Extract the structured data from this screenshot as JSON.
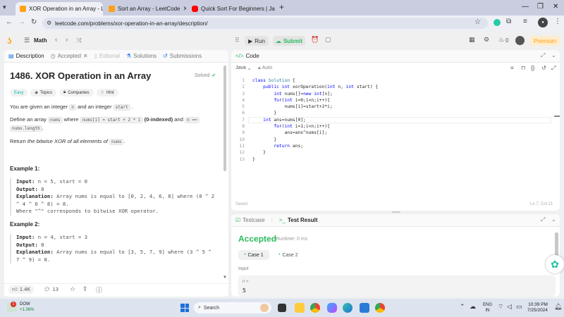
{
  "browser": {
    "tabs": [
      {
        "title": "XOR Operation in an Array - Le",
        "fav_color": "#ffa116"
      },
      {
        "title": "Sort an Array - LeetCode",
        "fav_color": "#ffa116"
      },
      {
        "title": "Quick Sort For Beginners | Java",
        "fav_color": "#ff0000"
      }
    ],
    "new_tab": "+",
    "url": "leetcode.com/problems/xor-operation-in-an-array/description/"
  },
  "header": {
    "problem_list": "Math",
    "run_label": "Run",
    "submit_label": "Submit",
    "streak": "0",
    "premium_label": "Premium"
  },
  "left": {
    "tabs": [
      "Description",
      "Accepted",
      "Editorial",
      "Solutions",
      "Submissions"
    ],
    "title": "1486. XOR Operation in an Array",
    "solved": "Solved",
    "tags": [
      "Easy",
      "Topics",
      "Companies",
      "Hint"
    ],
    "p1_a": "You are given an integer",
    "p1_n": "n",
    "p1_b": "and an integer",
    "p1_start": "start",
    "p2_a": "Define an array",
    "p2_nums": "nums",
    "p2_b": "where",
    "p2_expr": "nums[i] = start + 2 * i",
    "p2_c": "(0-indexed)",
    "p2_d": "and",
    "p2_n": "n ==",
    "p2_len": "nums.length",
    "p3_a": "Return",
    "p3_b": "the bitwise XOR of all elements of",
    "p3_nums": "nums",
    "ex1_title": "Example 1:",
    "ex1_input_k": "Input:",
    "ex1_input_v": "n = 5, start = 0",
    "ex1_output_k": "Output:",
    "ex1_output_v": "8",
    "ex1_expl_k": "Explanation:",
    "ex1_expl_v1": "Array nums is equal to [0, 2, 4, 6, 8] where (0 ^ 2",
    "ex1_expl_v2": "^ 4 ^ 6 ^ 8) = 8.",
    "ex1_expl_v3": "Where \"^\" corresponds to bitwise XOR operator.",
    "ex2_title": "Example 2:",
    "ex2_input_k": "Input:",
    "ex2_input_v": "n = 4, start = 3",
    "ex2_output_k": "Output:",
    "ex2_output_v": "8",
    "ex2_expl_k": "Explanation:",
    "ex2_expl_v1": "Array nums is equal to [3, 5, 7, 9] where (3 ^ 5 ^",
    "ex2_expl_v2": "7 ^ 9) = 8.",
    "likes": "1.4K",
    "comments": "13"
  },
  "code": {
    "tab": "Code",
    "language": "Java",
    "mode": "Auto",
    "lines": [
      "class Solution {",
      "    public int xorOperation(int n, int start) {",
      "        int nums[]=new int[n];",
      "        for(int i=0;i<n;i++){",
      "            nums[i]=start+2*i;",
      "        }",
      "    int ans=nums[0];",
      "        for(int i=1;i<n;i++){",
      "            ans=ans^nums[i];",
      "        }",
      "        return ans;",
      "    }",
      "}"
    ],
    "saved": "Saved",
    "cursor": "Ln 7, Col 21"
  },
  "result": {
    "tab_testcase": "Testcase",
    "tab_result": "Test Result",
    "status": "Accepted",
    "runtime": "Runtime: 0 ms",
    "cases": [
      "Case 1",
      "Case 2"
    ],
    "input_label": "Input",
    "var_label": "n =",
    "var_value": "5"
  },
  "taskbar": {
    "stock_name": "DOW",
    "stock_change": "+1.36%",
    "search": "Search",
    "lang1": "ENG",
    "lang2": "IN",
    "time": "10:39 PM",
    "date": "7/25/2024",
    "badge": "1"
  }
}
